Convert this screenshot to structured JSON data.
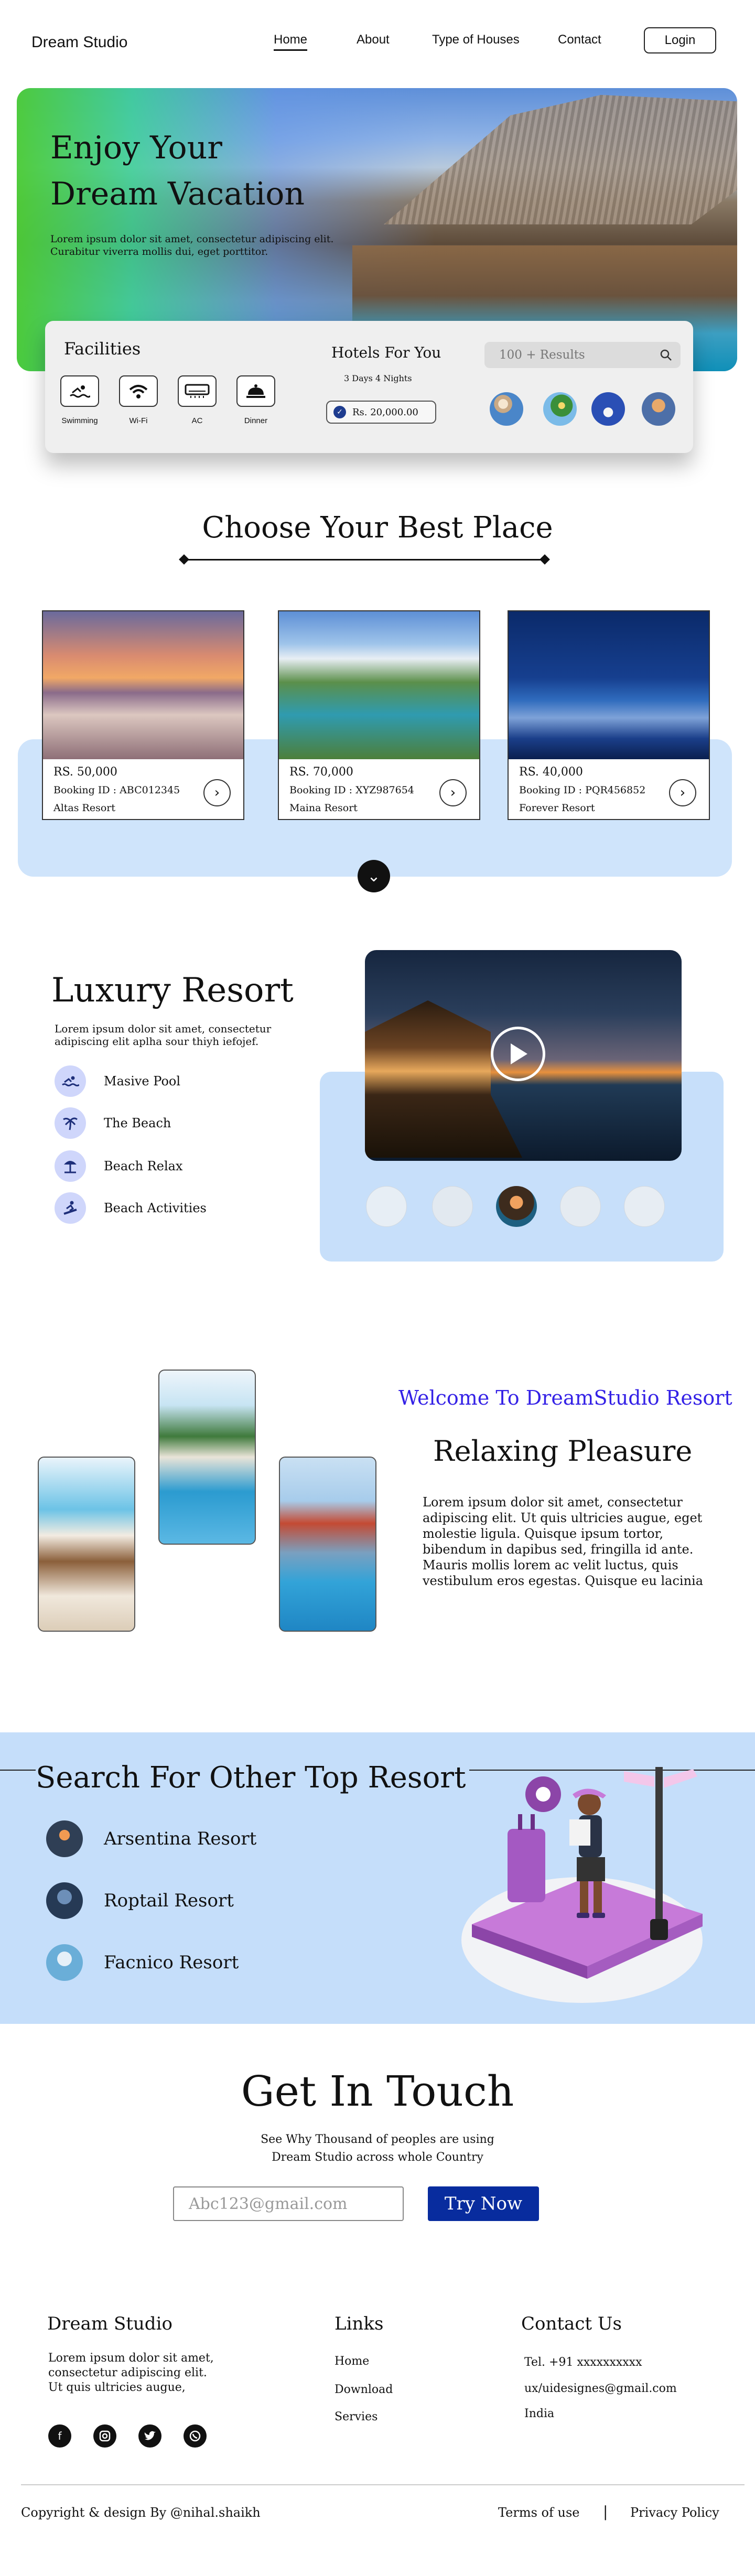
{
  "brand": "Dream Studio",
  "nav": {
    "items": [
      "Home",
      "About",
      "Type of Houses",
      "Contact"
    ],
    "login": "Login"
  },
  "hero": {
    "title_line1": "Enjoy Your",
    "title_line2": "Dream Vacation",
    "subtitle_line1": "Lorem ipsum dolor sit amet, consectetur adipiscing elit.",
    "subtitle_line2": "Curabitur viverra mollis dui, eget porttitor."
  },
  "search_card": {
    "facilities_title": "Facilities",
    "facilities": [
      {
        "label": "Swimming",
        "icon": "swimming-icon"
      },
      {
        "label": "Wi-Fi",
        "icon": "wifi-icon"
      },
      {
        "label": "AC",
        "icon": "ac-icon"
      },
      {
        "label": "Dinner",
        "icon": "dinner-icon"
      }
    ],
    "hotels_title": "Hotels For You",
    "nights": "3 Days 4 Nights",
    "price": "Rs. 20,000.00",
    "search_placeholder": "100 + Results"
  },
  "choose": {
    "title": "Choose Your Best Place",
    "cards": [
      {
        "price": "RS. 50,000",
        "booking": "Booking ID : ABC012345",
        "name": "Altas Resort"
      },
      {
        "price": "RS. 70,000",
        "booking": "Booking ID : XYZ987654",
        "name": "Maina Resort"
      },
      {
        "price": "RS. 40,000",
        "booking": "Booking ID : PQR456852",
        "name": "Forever Resort"
      }
    ]
  },
  "luxury": {
    "title": "Luxury Resort",
    "subtitle": "Lorem ipsum dolor sit amet, consectetur adipiscing elit aplha sour thiyh iefojef.",
    "items": [
      "Masive Pool",
      "The Beach",
      "Beach Relax",
      "Beach Activities"
    ]
  },
  "relax": {
    "welcome": "Welcome To DreamStudio Resort",
    "title": "Relaxing Pleasure",
    "body": "Lorem ipsum dolor sit amet, consectetur adipiscing elit. Ut quis ultricies augue, eget molestie ligula. Quisque ipsum tortor, bibendum in dapibus sed, fringilla id ante. Mauris mollis lorem ac velit luctus, quis vestibulum eros egestas. Quisque eu lacinia"
  },
  "other": {
    "title": "Search For Other Top Resort",
    "resorts": [
      "Arsentina Resort",
      "Roptail Resort",
      "Facnico Resort"
    ]
  },
  "contact": {
    "title": "Get In Touch",
    "sub_line1": "See Why Thousand of peoples are using",
    "sub_line2": "Dream Studio across whole Country",
    "email_placeholder": "Abc123@gmail.com",
    "button": "Try Now"
  },
  "footer": {
    "brand": "Dream Studio",
    "about_line1": "Lorem ipsum dolor sit amet,",
    "about_line2": "consectetur adipiscing elit.",
    "about_line3": "Ut quis ultricies augue,",
    "links_title": "Links",
    "links": [
      "Home",
      "Download",
      "Servies"
    ],
    "contact_title": "Contact Us",
    "phone": "Tel. +91 xxxxxxxxxx",
    "email": "ux/uidesignes@gmail.com",
    "country": "India",
    "copyright": "Copyright & design By @nihal.shaikh",
    "terms": "Terms of use",
    "separator": "|",
    "privacy": "Privacy Policy"
  }
}
